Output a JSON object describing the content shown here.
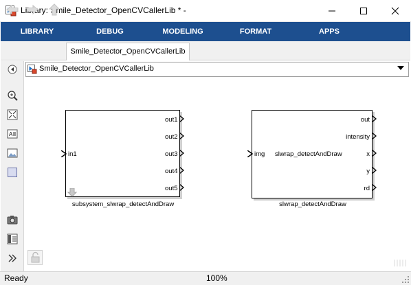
{
  "window": {
    "title": "Library: Smile_Detector_OpenCVCallerLib * -"
  },
  "ribbon": {
    "tabs": [
      {
        "label": "LIBRARY"
      },
      {
        "label": "DEBUG"
      },
      {
        "label": "MODELING"
      },
      {
        "label": "FORMAT"
      },
      {
        "label": "APPS"
      }
    ]
  },
  "nav": {
    "tab_label": "Smile_Detector_OpenCVCallerLib"
  },
  "address": {
    "path": "Smile_Detector_OpenCVCallerLib"
  },
  "blocks": {
    "subsystem": {
      "name": "subsystem_slwrap_detectAndDraw",
      "inputs": [
        "in1"
      ],
      "outputs": [
        "out1",
        "out2",
        "out3",
        "out4",
        "out5"
      ]
    },
    "slwrap": {
      "name": "slwrap_detectAndDraw",
      "center_label": "slwrap_detectAndDraw",
      "inputs": [
        "img"
      ],
      "outputs": [
        "out",
        "intensity",
        "x",
        "y",
        "rd"
      ]
    }
  },
  "status": {
    "text": "Ready",
    "zoom": "100%"
  },
  "colors": {
    "ribbon": "#1d4f8f",
    "chrome": "#f0f0f0"
  }
}
